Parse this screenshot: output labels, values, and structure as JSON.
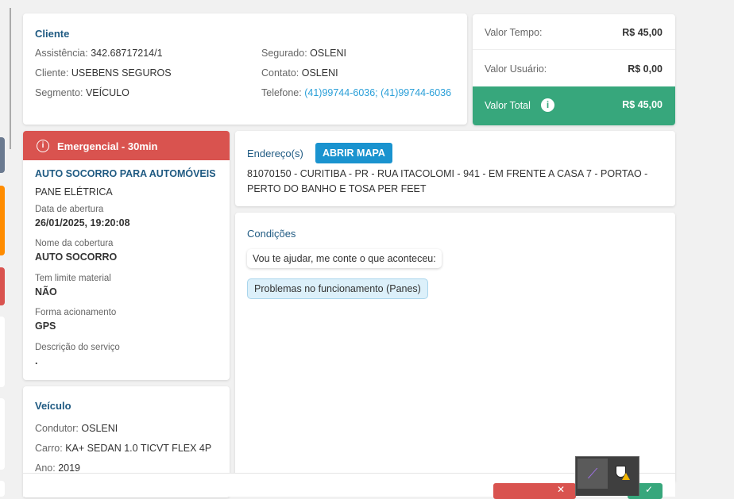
{
  "cliente": {
    "title": "Cliente",
    "left": [
      {
        "label": "Assistência:",
        "value": "342.68717214/1"
      },
      {
        "label": "Cliente:",
        "value": "USEBENS SEGUROS"
      },
      {
        "label": "Segmento:",
        "value": "VEÍCULO"
      }
    ],
    "right": [
      {
        "label": "Segurado:",
        "value": "OSLENI"
      },
      {
        "label": "Contato:",
        "value": "OSLENI"
      },
      {
        "label": "Telefone:",
        "value": "(41)99744-6036; (41)99744-6036"
      }
    ]
  },
  "valores": {
    "tempo_label": "Valor Tempo:",
    "tempo": "R$ 45,00",
    "usuario_label": "Valor Usuário:",
    "usuario": "R$ 0,00",
    "total_label": "Valor Total",
    "total": "R$ 45,00"
  },
  "servico": {
    "badge": "Emergencial - 30min",
    "title": "AUTO SOCORRO PARA AUTOMÓVEIS",
    "subtitle": "PANE ELÉTRICA",
    "fields": [
      {
        "label": "Data de abertura",
        "value": "26/01/2025, 19:20:08"
      },
      {
        "label": "Nome da cobertura",
        "value": "AUTO SOCORRO"
      },
      {
        "label": "Tem limite material",
        "value": "NÃO"
      },
      {
        "label": "Forma acionamento",
        "value": "GPS"
      },
      {
        "label": "Descrição do serviço",
        "value": "."
      }
    ]
  },
  "veiculo": {
    "title": "Veículo",
    "rows": [
      {
        "label": "Condutor:",
        "value": "OSLENI"
      },
      {
        "label": "Carro:",
        "value": "KA+ SEDAN 1.0 TICVT FLEX 4P"
      },
      {
        "label": "Ano:",
        "value": "2019"
      }
    ]
  },
  "endereco": {
    "title": "Endereço(s)",
    "map_button": "ABRIR MAPA",
    "address": "81070150 - CURITIBA - PR - RUA ITACOLOMI - 941 - EM FRENTE A CASA 7 - PORTAO - PERTO DO BANHO E TOSA PER FEET"
  },
  "condicoes": {
    "title": "Condições",
    "question": "Vou te ajudar, me conte o que aconteceu:",
    "answer": "Problemas no funcionamento (Panes)"
  },
  "colors": {
    "accent": "#1f5a82",
    "danger": "#d9534f",
    "success": "#37a77c",
    "button": "#1a93cf"
  }
}
